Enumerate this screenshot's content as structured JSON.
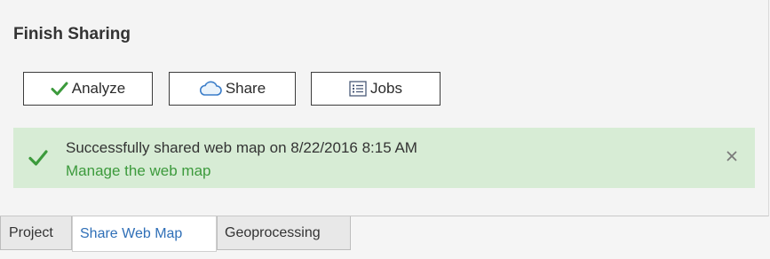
{
  "finish_sharing": {
    "title": "Finish Sharing",
    "buttons": {
      "analyze_label": "Analyze",
      "share_label": "Share",
      "jobs_label": "Jobs"
    }
  },
  "success_message": {
    "text": "Successfully shared web map on 8/22/2016 8:15 AM",
    "link_text": "Manage the web map"
  },
  "tabs": [
    {
      "label": "Project",
      "active": false
    },
    {
      "label": "Share Web Map",
      "active": true
    },
    {
      "label": "Geoprocessing",
      "active": false
    }
  ],
  "icons": {
    "analyze": "checkmark-icon",
    "share": "cloud-icon",
    "jobs": "list-icon",
    "success": "checkmark-icon",
    "dismiss": "close-icon"
  },
  "colors": {
    "success_background": "#d7ecd5",
    "success_check": "#3c9a3c",
    "link": "#3c9a3c",
    "active_tab_text": "#2f6fb7",
    "cloud_icon": "#3a7dc9"
  }
}
